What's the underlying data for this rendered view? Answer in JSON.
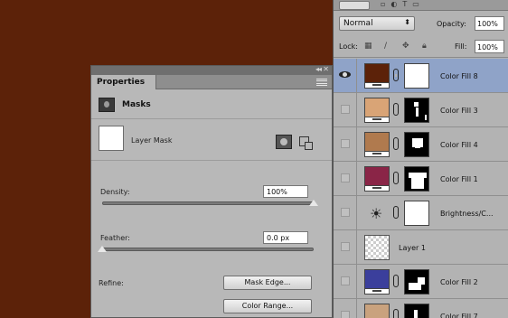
{
  "colors": {
    "canvas_fill": "#5c2209",
    "selected_row": "#8fa3c8"
  },
  "properties": {
    "tab_label": "Properties",
    "section_label": "Masks",
    "mask_type_label": "Layer Mask",
    "density_label": "Density:",
    "density_value": "100%",
    "density_level": 1.0,
    "feather_label": "Feather:",
    "feather_value": "0.0 px",
    "feather_level": 0.0,
    "refine_label": "Refine:",
    "mask_edge_button": "Mask Edge...",
    "color_range_button": "Color Range...",
    "icons": [
      "mask-icon",
      "pixel-mask-icon",
      "vector-mask-icon",
      "panel-menu-icon",
      "collapse-icon",
      "close-icon"
    ]
  },
  "layers_panel": {
    "blend_mode": "Normal",
    "opacity_label": "Opacity:",
    "opacity_value": "100%",
    "lock_label": "Lock:",
    "fill_label": "Fill:",
    "fill_value": "100%",
    "lock_icons": [
      "lock-transparent-icon",
      "lock-paint-icon",
      "lock-move-icon",
      "lock-all-icon"
    ],
    "layers": [
      {
        "name": "Color Fill 8",
        "fill_color": "#5c2209",
        "visible": true,
        "selected": true,
        "mask": "white"
      },
      {
        "name": "Color Fill 3",
        "fill_color": "#d9a476",
        "visible": false,
        "selected": false,
        "mask": "figure"
      },
      {
        "name": "Color Fill 4",
        "fill_color": "#b07a4e",
        "visible": false,
        "selected": false,
        "mask": "hair"
      },
      {
        "name": "Color Fill 1",
        "fill_color": "#8a2547",
        "visible": false,
        "selected": false,
        "mask": "dress"
      },
      {
        "name": "Brightness/C...",
        "fill_color": "",
        "visible": false,
        "selected": false,
        "mask": "white"
      },
      {
        "name": "Layer 1",
        "fill_color": "",
        "visible": false,
        "selected": false,
        "mask": "none"
      },
      {
        "name": "Color Fill 2",
        "fill_color": "#3b3f9c",
        "visible": false,
        "selected": false,
        "mask": "shoes"
      },
      {
        "name": "Color Fill 7",
        "fill_color": "#c9a27e",
        "visible": false,
        "selected": false,
        "mask": "arm"
      }
    ]
  }
}
